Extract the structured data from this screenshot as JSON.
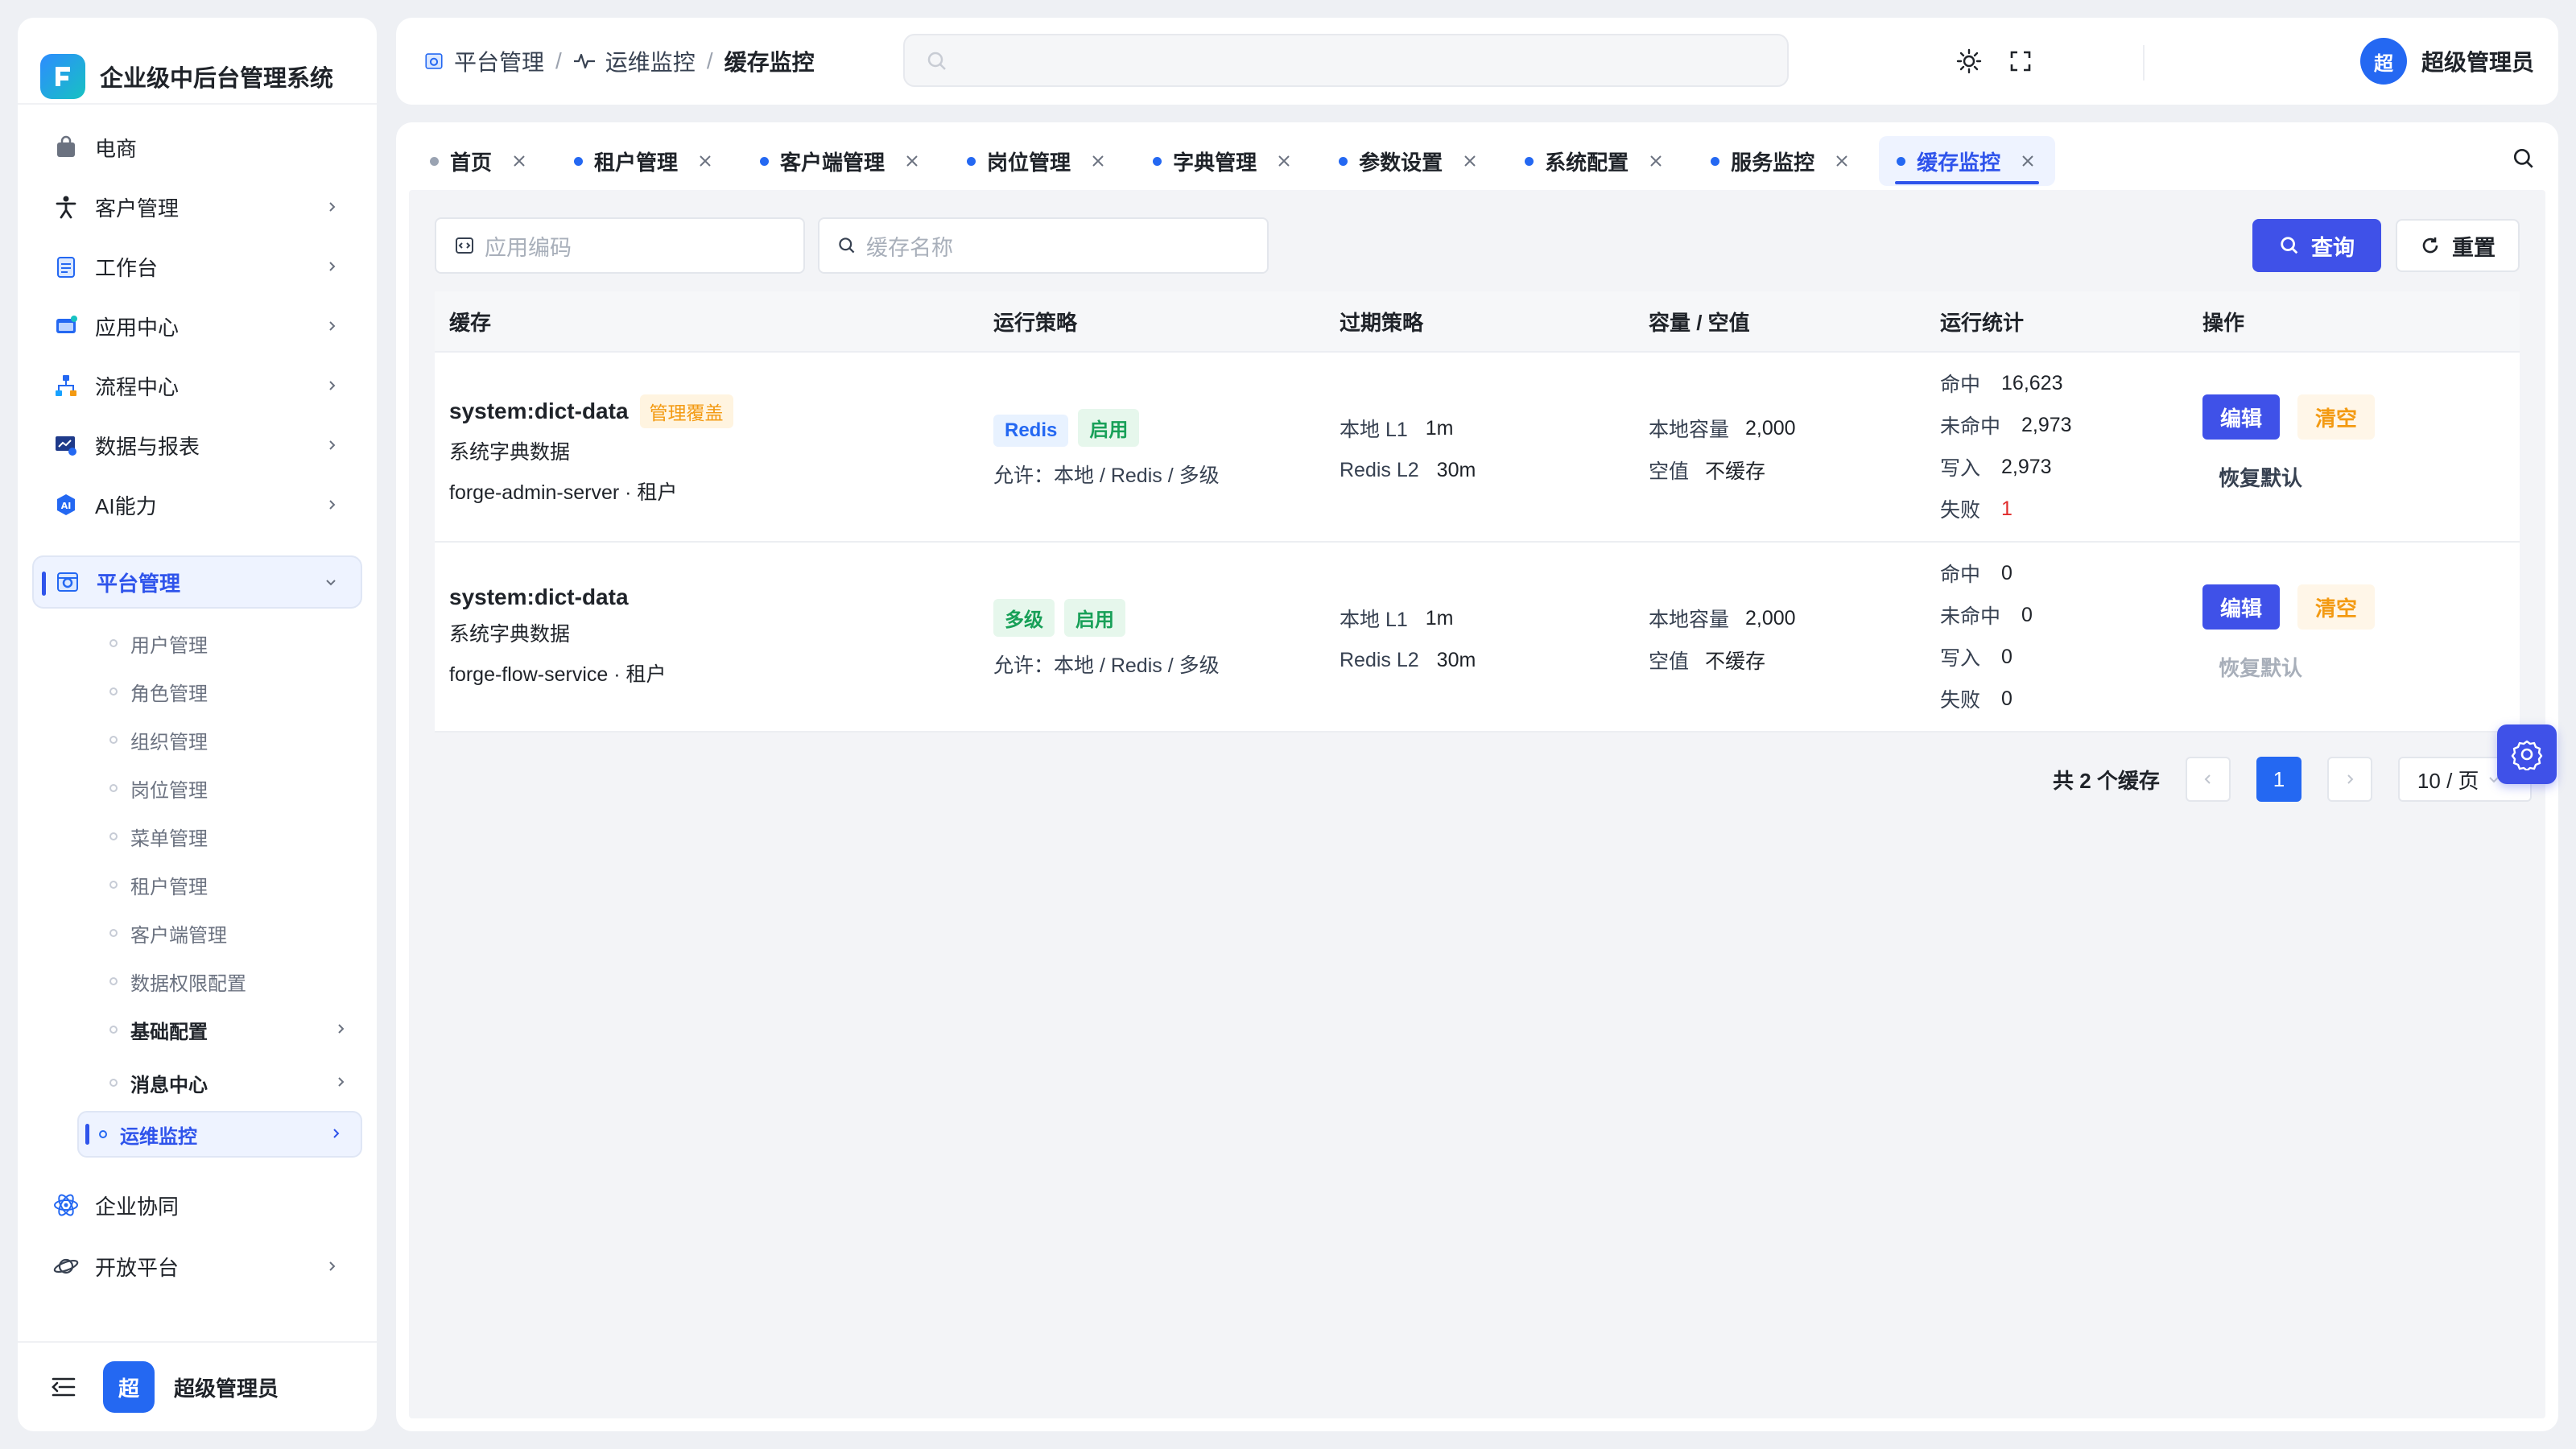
{
  "app": {
    "title": "企业级中后台管理系统"
  },
  "sidebar": {
    "menu": [
      {
        "label": "电商"
      },
      {
        "label": "客户管理"
      },
      {
        "label": "工作台"
      },
      {
        "label": "应用中心"
      },
      {
        "label": "流程中心"
      },
      {
        "label": "数据与报表"
      },
      {
        "label": "AI能力"
      },
      {
        "label": "平台管理"
      }
    ],
    "platform_sub": [
      {
        "label": "用户管理"
      },
      {
        "label": "角色管理"
      },
      {
        "label": "组织管理"
      },
      {
        "label": "岗位管理"
      },
      {
        "label": "菜单管理"
      },
      {
        "label": "租户管理"
      },
      {
        "label": "客户端管理"
      },
      {
        "label": "数据权限配置"
      },
      {
        "label": "基础配置"
      },
      {
        "label": "消息中心"
      },
      {
        "label": "运维监控"
      }
    ],
    "menu_after": [
      {
        "label": "企业协同"
      },
      {
        "label": "开放平台"
      }
    ],
    "bottom_avatar": "超",
    "bottom_user": "超级管理员"
  },
  "header": {
    "breadcrumb": [
      "平台管理",
      "运维监控",
      "缓存监控"
    ],
    "search_placeholder": "",
    "user_avatar": "超",
    "user_name": "超级管理员"
  },
  "tabs": [
    {
      "label": "首页"
    },
    {
      "label": "租户管理"
    },
    {
      "label": "客户端管理"
    },
    {
      "label": "岗位管理"
    },
    {
      "label": "字典管理"
    },
    {
      "label": "参数设置"
    },
    {
      "label": "系统配置"
    },
    {
      "label": "服务监控"
    },
    {
      "label": "缓存监控"
    }
  ],
  "filters": {
    "app_code_placeholder": "应用编码",
    "cache_name_placeholder": "缓存名称",
    "query_label": "查询",
    "reset_label": "重置"
  },
  "table": {
    "headers": [
      "缓存",
      "运行策略",
      "过期策略",
      "容量 / 空值",
      "运行统计",
      "操作"
    ],
    "rows": [
      {
        "name": "system:dict-data",
        "badge": "管理覆盖",
        "desc": "系统字典数据",
        "service": "forge-admin-server · 租户",
        "strategy_tag": "Redis",
        "status_tag": "启用",
        "allow": "允许：本地 / Redis / 多级",
        "local_l1_label": "本地 L1",
        "local_l1_value": "1m",
        "redis_l2_label": "Redis L2",
        "redis_l2_value": "30m",
        "capacity_label": "本地容量",
        "capacity_value": "2,000",
        "null_label": "空值",
        "null_value": "不缓存",
        "hit_label": "命中",
        "hit_value": "16,623",
        "miss_label": "未命中",
        "miss_value": "2,973",
        "write_label": "写入",
        "write_value": "2,973",
        "fail_label": "失败",
        "fail_value": "1",
        "edit_label": "编辑",
        "clear_label": "清空",
        "reset_label": "恢复默认"
      },
      {
        "name": "system:dict-data",
        "badge": "",
        "desc": "系统字典数据",
        "service": "forge-flow-service · 租户",
        "strategy_tag": "多级",
        "status_tag": "启用",
        "allow": "允许：本地 / Redis / 多级",
        "local_l1_label": "本地 L1",
        "local_l1_value": "1m",
        "redis_l2_label": "Redis L2",
        "redis_l2_value": "30m",
        "capacity_label": "本地容量",
        "capacity_value": "2,000",
        "null_label": "空值",
        "null_value": "不缓存",
        "hit_label": "命中",
        "hit_value": "0",
        "miss_label": "未命中",
        "miss_value": "0",
        "write_label": "写入",
        "write_value": "0",
        "fail_label": "失败",
        "fail_value": "0",
        "edit_label": "编辑",
        "clear_label": "清空",
        "reset_label": "恢复默认"
      }
    ]
  },
  "pagination": {
    "total_text": "共 2 个缓存",
    "current_page": "1",
    "page_size": "10 / 页"
  },
  "colors": {
    "primary": "#3f51e8",
    "brand_blue": "#2468f2",
    "warning": "#f39a12",
    "success": "#18a058",
    "danger": "#e02c2c"
  }
}
